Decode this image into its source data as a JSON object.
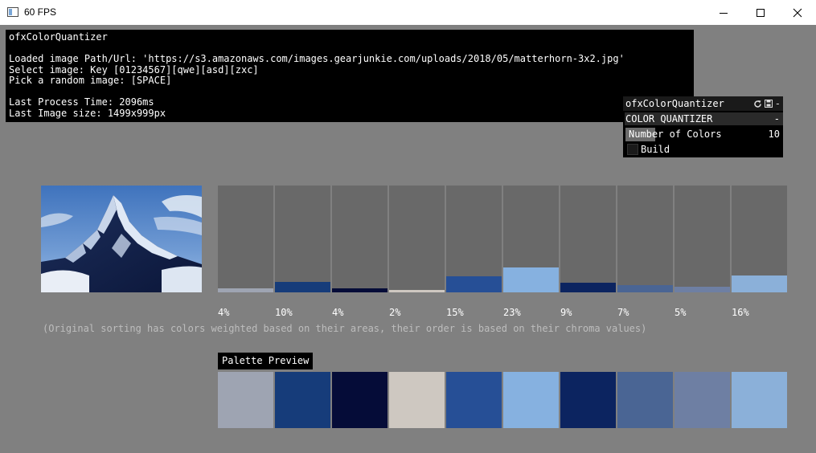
{
  "window": {
    "title": "60 FPS"
  },
  "info": {
    "app_name": "ofxColorQuantizer",
    "image_path_line": "Loaded image Path/Url: 'https://s3.amazonaws.com/images.gearjunkie.com/uploads/2018/05/matterhorn-3x2.jpg'",
    "select_line": "Select image: Key [01234567][qwe][asd][zxc]",
    "random_line": "Pick a random image: [SPACE]",
    "process_time_line": "Last Process Time: 2096ms",
    "image_size_line": "Last Image size: 1499x999px"
  },
  "gui": {
    "title": "ofxColorQuantizer",
    "section": "COLOR QUANTIZER",
    "collapse_symbol": "-",
    "slider_label": "Number of Colors",
    "slider_value": "10",
    "slider_fraction": 0.19,
    "build_label": "Build"
  },
  "colors": [
    {
      "percent": "4%",
      "fill": 0.04,
      "hex": "#9ea4b2"
    },
    {
      "percent": "10%",
      "fill": 0.1,
      "hex": "#163c7a"
    },
    {
      "percent": "4%",
      "fill": 0.04,
      "hex": "#050c38"
    },
    {
      "percent": "2%",
      "fill": 0.02,
      "hex": "#cec8c1"
    },
    {
      "percent": "15%",
      "fill": 0.15,
      "hex": "#264f96"
    },
    {
      "percent": "23%",
      "fill": 0.23,
      "hex": "#86b1e0"
    },
    {
      "percent": "9%",
      "fill": 0.09,
      "hex": "#0c2460"
    },
    {
      "percent": "7%",
      "fill": 0.07,
      "hex": "#4a6594"
    },
    {
      "percent": "5%",
      "fill": 0.05,
      "hex": "#6e7fa3"
    },
    {
      "percent": "16%",
      "fill": 0.16,
      "hex": "#8bb0d9"
    }
  ],
  "note": "(Original sorting has colors weighted based on their areas, their order is based on their chroma values)",
  "palette_label": "Palette Preview"
}
